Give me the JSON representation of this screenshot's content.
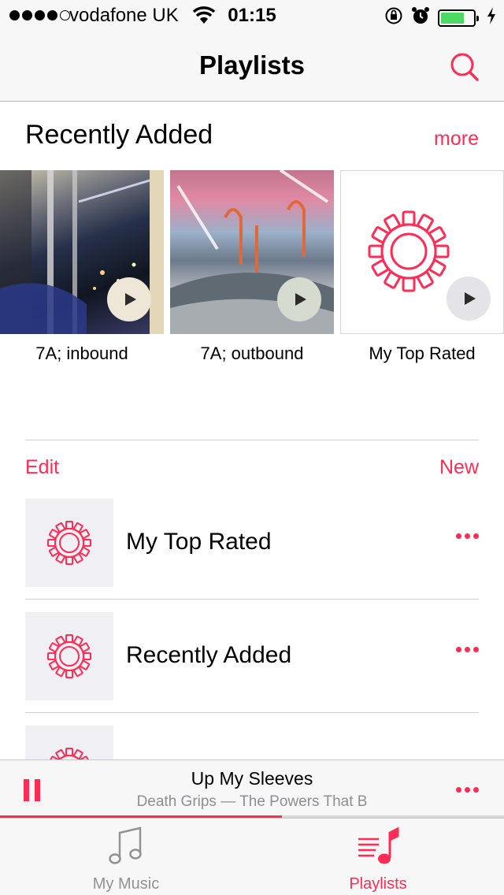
{
  "status_bar": {
    "carrier": "vodafone UK",
    "time": "01:15",
    "signal_bars": 4,
    "signal_total": 5,
    "battery_level": 0.72,
    "icons": [
      "wifi-icon",
      "rotation-lock-icon",
      "alarm-icon",
      "battery-icon",
      "charging-icon"
    ]
  },
  "nav": {
    "title": "Playlists",
    "search_icon": "search-icon"
  },
  "recently_added": {
    "title": "Recently Added",
    "more_label": "more",
    "cards": [
      {
        "label": "7A; inbound",
        "art": "photo-bus-interior-night"
      },
      {
        "label": "7A; outbound",
        "art": "photo-bus-interior-pink"
      },
      {
        "label": "My Top Rated",
        "art": "gear-icon"
      }
    ]
  },
  "list_header": {
    "edit_label": "Edit",
    "new_label": "New"
  },
  "playlists": [
    {
      "name": "My Top Rated",
      "icon": "gear-icon"
    },
    {
      "name": "Recently Added",
      "icon": "gear-icon"
    },
    {
      "name": "",
      "icon": "gear-icon"
    }
  ],
  "mini_player": {
    "title": "Up My Sleeves",
    "subtitle": "Death Grips — The Powers That B",
    "progress": 0.56
  },
  "tabs": [
    {
      "label": "My Music",
      "icon": "music-note-icon",
      "active": false
    },
    {
      "label": "Playlists",
      "icon": "playlist-icon",
      "active": true
    }
  ],
  "colors": {
    "accent": "#ff2d55",
    "bar_background": "#f7f7f7",
    "thumb_background": "#efeff4",
    "inactive_tab": "#929292"
  }
}
